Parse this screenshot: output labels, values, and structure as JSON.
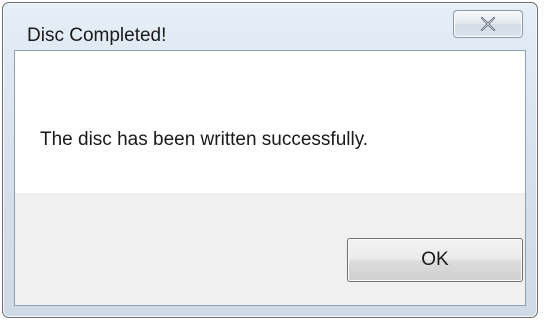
{
  "dialog": {
    "title": "Disc Completed!",
    "message": "The disc has been written successfully.",
    "ok_label": "OK",
    "close_icon": "close-icon"
  },
  "colors": {
    "title_bar": "#dce6f1",
    "frame_border": "#6f6f6f",
    "client_background": "#ffffff",
    "button_strip": "#f0f0f0",
    "text": "#1a1a1a"
  }
}
